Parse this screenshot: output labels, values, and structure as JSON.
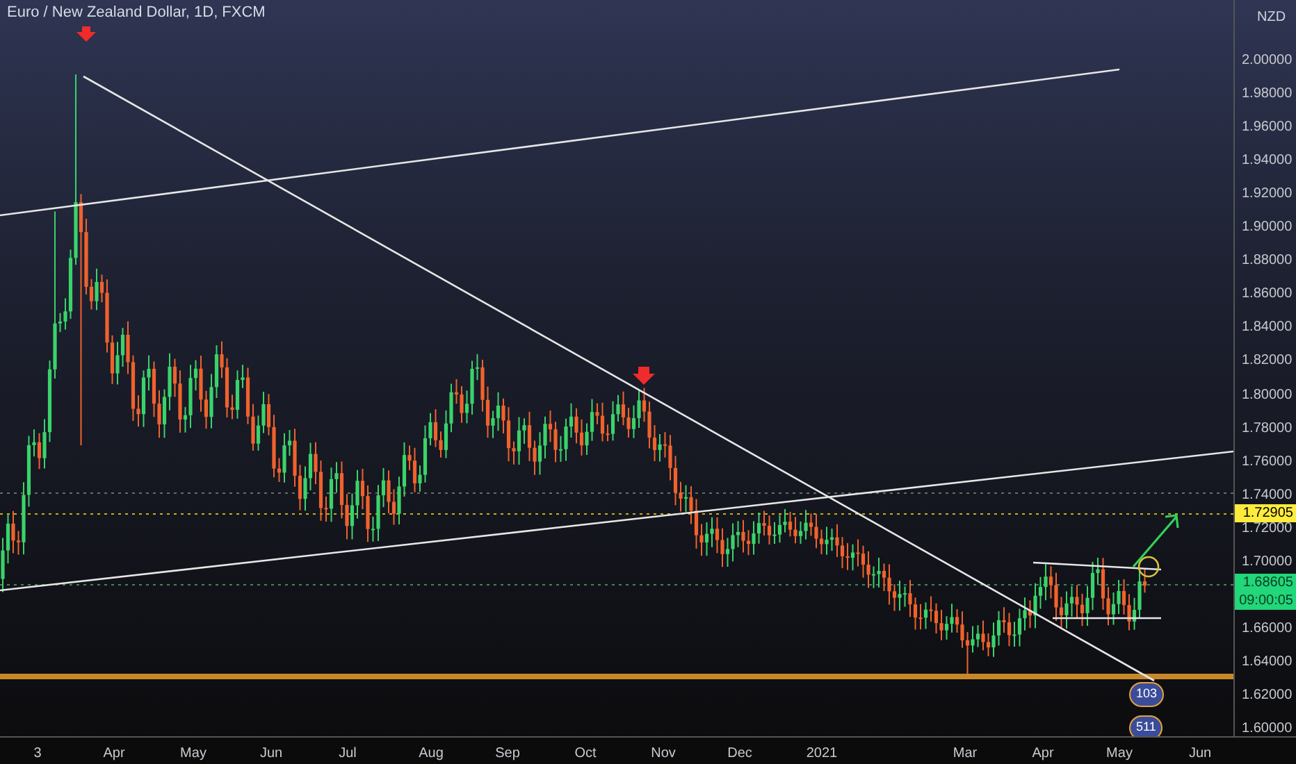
{
  "chart": {
    "title": "Euro / New Zealand Dollar, 1D, FXCM",
    "currency": "NZD",
    "price_labels": [
      "2.00000",
      "1.98000",
      "1.96000",
      "1.94000",
      "1.92000",
      "1.90000",
      "1.88000",
      "1.86000",
      "1.84000",
      "1.82000",
      "1.80000",
      "1.78000",
      "1.76000",
      "1.74000",
      "1.72000",
      "1.70000",
      "1.66000",
      "1.64000",
      "1.62000",
      "1.60000"
    ],
    "time_labels": [
      "3",
      "Apr",
      "May",
      "Jun",
      "Jul",
      "Aug",
      "Sep",
      "Oct",
      "Nov",
      "Dec",
      "2021",
      "Mar",
      "Apr",
      "May",
      "Jun"
    ],
    "price_tags": [
      {
        "kind": "alert",
        "value": "1.72905"
      },
      {
        "kind": "last",
        "value": "1.68605",
        "countdown": "09:00:05"
      }
    ],
    "event_badges": [
      {
        "count": "103"
      },
      {
        "count": "511"
      }
    ]
  }
}
